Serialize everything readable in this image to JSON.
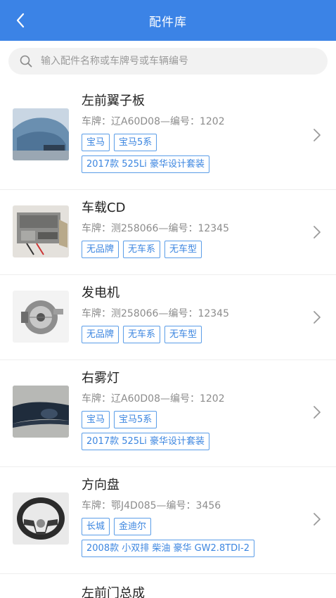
{
  "header": {
    "title": "配件库",
    "back_icon": "chevron-left-icon"
  },
  "search": {
    "placeholder": "输入配件名称或车牌号或车辆编号",
    "icon": "search-icon"
  },
  "items": [
    {
      "name": "左前翼子板",
      "meta": "车牌：辽A60D08—编号：1202",
      "tags_row1": [
        "宝马",
        "宝马5系"
      ],
      "tags_row2": [
        "2017款 525Li 豪华设计套装"
      ]
    },
    {
      "name": "车载CD",
      "meta": "车牌：测258066—编号：12345",
      "tags_row1": [
        "无品牌",
        "无车系",
        "无车型"
      ],
      "tags_row2": []
    },
    {
      "name": "发电机",
      "meta": "车牌：测258066—编号：12345",
      "tags_row1": [
        "无品牌",
        "无车系",
        "无车型"
      ],
      "tags_row2": []
    },
    {
      "name": "右雾灯",
      "meta": "车牌：辽A60D08—编号：1202",
      "tags_row1": [
        "宝马",
        "宝马5系"
      ],
      "tags_row2": [
        "2017款 525Li 豪华设计套装"
      ]
    },
    {
      "name": "方向盘",
      "meta": "车牌：鄂J4D085—编号：3456",
      "tags_row1": [
        "长城",
        "金迪尔"
      ],
      "tags_row2": [
        "2008款 小双排 柴油 豪华 GW2.8TDI-2"
      ]
    },
    {
      "name": "左前门总成"
    }
  ],
  "colors": {
    "header_bg": "#3b83e6",
    "tag_border": "#5a9de8",
    "tag_text": "#3c86e0"
  }
}
